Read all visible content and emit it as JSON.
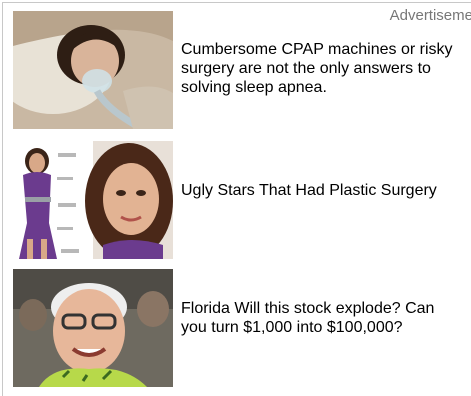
{
  "header": {
    "ad_label": "Advertiseme"
  },
  "ads": [
    {
      "headline": "Cumbersome CPAP machines or risky surgery are not the only answers to solving sleep apnea.",
      "image_icon": "cpap-mask-photo"
    },
    {
      "headline": "Ugly Stars That Had Plastic Surgery",
      "image_icon": "celebrity-photo"
    },
    {
      "headline": "Florida Will this stock explode? Can you turn $1,000 into $100,000?",
      "image_icon": "investor-photo"
    }
  ],
  "colors": {
    "border": "#c8c8c8",
    "label": "#777777",
    "text": "#000000"
  }
}
